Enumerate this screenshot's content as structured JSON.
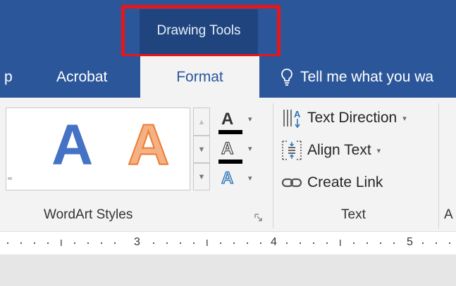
{
  "title_bar": {
    "context_tab_label": "Drawing Tools"
  },
  "tabs": {
    "partial_left": "p",
    "acrobat": "Acrobat",
    "format": "Format",
    "tell_me": "Tell me what you wa"
  },
  "wordart": {
    "samples": [
      "A",
      "A"
    ],
    "format_buttons": [
      "A",
      "A",
      "A"
    ],
    "group_label": "WordArt Styles",
    "scroll_glyphs": {
      "up": "▲",
      "down": "▼",
      "more": "▼"
    }
  },
  "text_group": {
    "commands": [
      "Text Direction",
      "Align Text",
      "Create Link"
    ],
    "caret": "▾",
    "group_label": "Text",
    "next_group_partial": "A"
  },
  "ruler": {
    "numbers": [
      "3",
      "4",
      "5"
    ]
  },
  "colors": {
    "ribbon_blue": "#2b579a",
    "context_dark": "#20457e",
    "highlight_red": "#e8161a",
    "wordart_blue": "#4472c4",
    "wordart_orange": "#ed7d31"
  },
  "icons": [
    "lightbulb-icon",
    "text-direction-icon",
    "align-text-icon",
    "link-icon",
    "dialog-launcher-icon"
  ]
}
